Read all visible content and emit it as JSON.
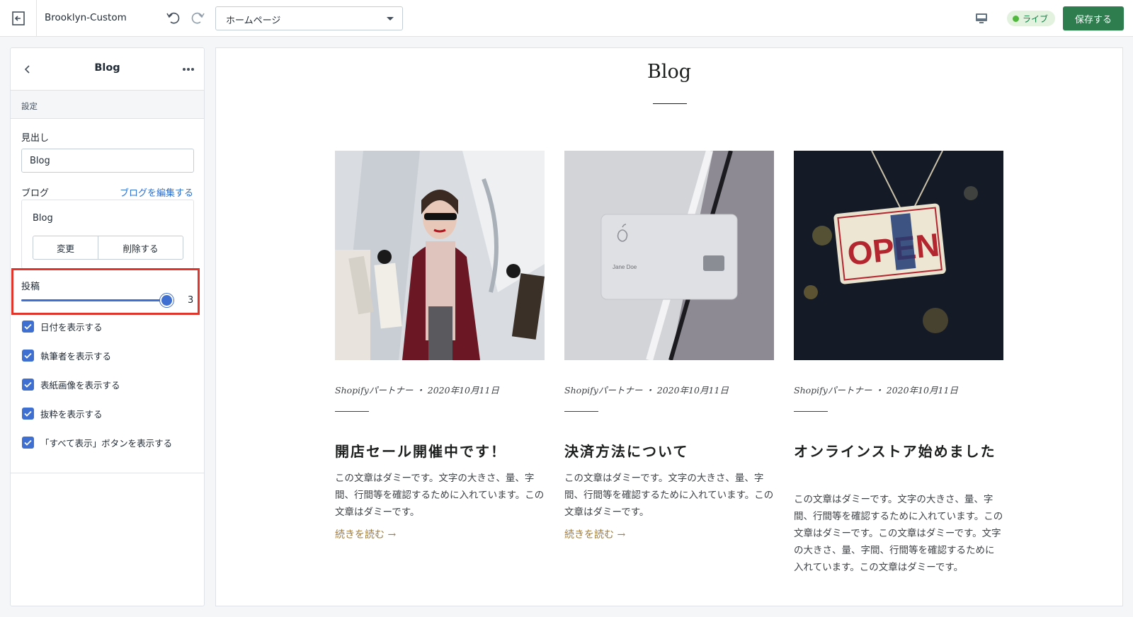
{
  "topbar": {
    "theme_name": "Brooklyn-Custom",
    "page_select_value": "ホームページ",
    "live_label": "ライブ",
    "save_label": "保存する"
  },
  "sidebar": {
    "title": "Blog",
    "section_label": "設定",
    "heading_label": "見出し",
    "heading_value": "Blog",
    "blog_label": "ブログ",
    "edit_blog_link": "ブログを編集する",
    "selected_blog": "Blog",
    "change_button": "変更",
    "delete_button": "削除する",
    "posts_label": "投稿",
    "posts_value": "3",
    "posts_fraction": 1.0,
    "checkboxes": [
      {
        "label": "日付を表示する",
        "checked": true
      },
      {
        "label": "執筆者を表示する",
        "checked": true
      },
      {
        "label": "表紙画像を表示する",
        "checked": true
      },
      {
        "label": "抜粋を表示する",
        "checked": true
      },
      {
        "label": "「すべて表示」ボタンを表示する",
        "checked": true
      }
    ]
  },
  "preview": {
    "title": "Blog",
    "posts": [
      {
        "meta": "Shopifyパートナー ・ 2020年10月11日",
        "title": "開店セール開催中です！",
        "excerpt": "この文章はダミーです。文字の大きさ、量、字間、行間等を確認するために入れています。この文章はダミーです。",
        "read_more": "続きを読む →"
      },
      {
        "meta": "Shopifyパートナー ・ 2020年10月11日",
        "title": "決済方法について",
        "excerpt": "この文章はダミーです。文字の大きさ、量、字間、行間等を確認するために入れています。この文章はダミーです。",
        "read_more": "続きを読む →",
        "card_name": "Jane Doe"
      },
      {
        "meta": "Shopifyパートナー ・ 2020年10月11日",
        "title": "オンラインストア始めました",
        "excerpt": "この文章はダミーです。文字の大きさ、量、字間、行間等を確認するために入れています。この文章はダミーです。この文章はダミーです。文字の大きさ、量、字間、行間等を確認するために入れています。この文章はダミーです。",
        "sign_text": "OPEN"
      }
    ]
  },
  "colors": {
    "primary_button": "#2e7d4f",
    "accent_blue": "#3f6fd0",
    "link_blue": "#2c6ecb",
    "highlight_red": "#e0352b",
    "read_more_gold": "#a27b3a"
  },
  "icons": [
    "exit-icon",
    "undo-icon",
    "redo-icon",
    "chevron-down-icon",
    "desktop-icon",
    "back-arrow-icon",
    "more-horizontal-icon",
    "checkmark-icon"
  ]
}
